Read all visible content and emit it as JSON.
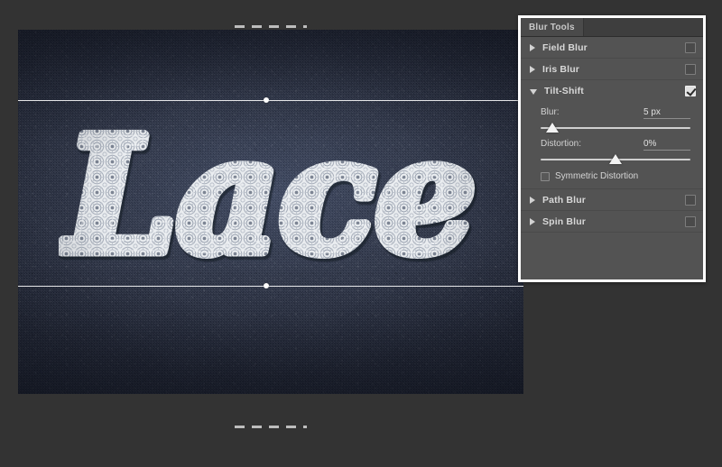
{
  "app": {
    "background_color": "#333333",
    "canvas_background_color": "#2b3348"
  },
  "canvas": {
    "artwork_text": "Lace",
    "artwork_description": "lace-script-word-on-denim",
    "overlay": {
      "top_dashed_guide": "blur-band-edge-top",
      "top_solid_guide": "focus-edge-top",
      "bottom_solid_guide": "focus-edge-bottom",
      "bottom_dashed_guide": "blur-band-edge-bottom"
    }
  },
  "panel": {
    "tab_label": "Blur Tools",
    "tools": [
      {
        "label": "Field Blur",
        "expanded": false,
        "checked": false,
        "arrow": "triangle-right-icon"
      },
      {
        "label": "Iris Blur",
        "expanded": false,
        "checked": false,
        "arrow": "triangle-right-icon"
      },
      {
        "label": "Tilt-Shift",
        "expanded": true,
        "checked": true,
        "arrow": "triangle-down-icon"
      },
      {
        "label": "Path Blur",
        "expanded": false,
        "checked": false,
        "arrow": "triangle-right-icon"
      },
      {
        "label": "Spin Blur",
        "expanded": false,
        "checked": false,
        "arrow": "triangle-right-icon"
      }
    ],
    "tiltshift": {
      "blur_label": "Blur:",
      "blur_value": "5 px",
      "blur_percent": 8,
      "distortion_label": "Distortion:",
      "distortion_value": "0%",
      "distortion_percent": 50,
      "symmetric_label": "Symmetric Distortion",
      "symmetric_checked": false
    }
  }
}
